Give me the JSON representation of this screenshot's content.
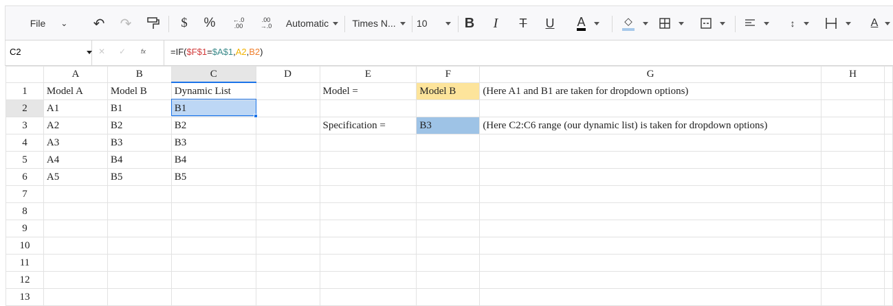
{
  "toolbar": {
    "file": "File",
    "number_format": "Automatic",
    "font": "Times N...",
    "font_size": "10",
    "currency": "$",
    "percent": "%",
    "inc_decimal": "←.0 .00",
    "dec_decimal": ".00 →.0",
    "bold": "B",
    "italic": "I",
    "strike": "T",
    "underline": "U",
    "font_color": "A",
    "text_rotate": "A"
  },
  "colors": {
    "fill_underline": "#a6c8ea",
    "font_color_underline": "#000000",
    "selection": "#bdd7f5",
    "f1_fill": "#fde49b",
    "f3_fill": "#9ec3e6",
    "accent": "#1a73e8"
  },
  "formula_bar": {
    "name_box": "C2",
    "fx": "fx",
    "formula_parts": [
      {
        "t": "=IF(",
        "c": "#222"
      },
      {
        "t": "$F$1",
        "c": "#d23b3b"
      },
      {
        "t": "=",
        "c": "#222"
      },
      {
        "t": "$A$1",
        "c": "#3a8a8a"
      },
      {
        "t": ",",
        "c": "#222"
      },
      {
        "t": "A2",
        "c": "#f2b300"
      },
      {
        "t": ",",
        "c": "#222"
      },
      {
        "t": "B2",
        "c": "#ee7d2b"
      },
      {
        "t": ")",
        "c": "#222"
      }
    ]
  },
  "columns": [
    "A",
    "B",
    "C",
    "D",
    "E",
    "F",
    "G",
    "H"
  ],
  "rows": [
    [
      "Model A",
      "Model B",
      "Dynamic List",
      "",
      "Model =",
      "Model B",
      "(Here A1 and B1 are taken for dropdown options)",
      ""
    ],
    [
      "A1",
      "B1",
      "B1",
      "",
      "",
      "",
      "",
      ""
    ],
    [
      "A2",
      "B2",
      "B2",
      "",
      "Specification =",
      "B3",
      "(Here C2:C6 range (our dynamic list) is taken for dropdown options)",
      ""
    ],
    [
      "A3",
      "B3",
      "B3",
      "",
      "",
      "",
      "",
      ""
    ],
    [
      "A4",
      "B4",
      "B4",
      "",
      "",
      "",
      "",
      ""
    ],
    [
      "A5",
      "B5",
      "B5",
      "",
      "",
      "",
      "",
      ""
    ],
    [
      "",
      "",
      "",
      "",
      "",
      "",
      "",
      ""
    ],
    [
      "",
      "",
      "",
      "",
      "",
      "",
      "",
      ""
    ],
    [
      "",
      "",
      "",
      "",
      "",
      "",
      "",
      ""
    ],
    [
      "",
      "",
      "",
      "",
      "",
      "",
      "",
      ""
    ],
    [
      "",
      "",
      "",
      "",
      "",
      "",
      "",
      ""
    ],
    [
      "",
      "",
      "",
      "",
      "",
      "",
      "",
      ""
    ],
    [
      "",
      "",
      "",
      "",
      "",
      "",
      "",
      ""
    ]
  ],
  "row_numbers": [
    "1",
    "2",
    "3",
    "4",
    "5",
    "6",
    "7",
    "8",
    "9",
    "10",
    "11",
    "12",
    "13"
  ]
}
